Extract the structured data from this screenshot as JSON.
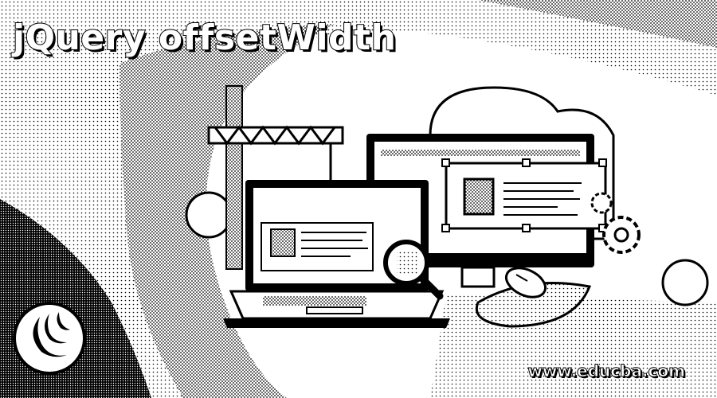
{
  "banner": {
    "title": "jQuery offsetWidth",
    "website": "www.educba.com"
  },
  "illustration": {
    "logo_icon": "jquery-logo-icon",
    "laptop_icon": "laptop-icon",
    "monitor_icon": "monitor-icon",
    "crane_icon": "crane-icon",
    "magnifier_icon": "magnifier-icon",
    "mouse_icon": "mouse-icon",
    "gear_icon": "gear-icon"
  },
  "colors": {
    "background": "#ffffff",
    "ink": "#000000"
  }
}
